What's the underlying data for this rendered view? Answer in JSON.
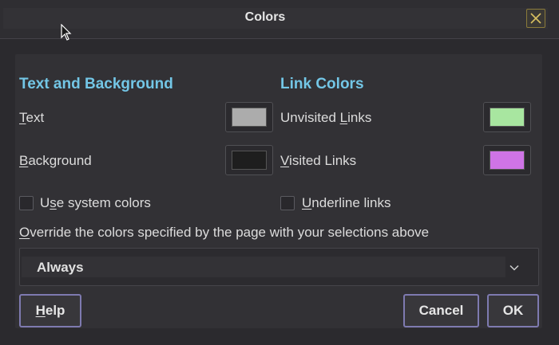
{
  "window": {
    "title": "Colors",
    "close_icon": "close-icon"
  },
  "text_background": {
    "heading": "Text and Background",
    "text_label_mnemonic": "T",
    "text_label_rest": "ext",
    "text_color": "#acacac",
    "background_label_mnemonic": "B",
    "background_label_rest": "ackground",
    "background_color": "#1e1e1e",
    "use_system_colors_prefix": "U",
    "use_system_colors_mnemonic": "s",
    "use_system_colors_rest": "e system colors",
    "use_system_colors_checked": false
  },
  "link_colors": {
    "heading": "Link Colors",
    "unvisited_prefix": "Unvisited ",
    "unvisited_mnemonic": "L",
    "unvisited_rest": "inks",
    "unvisited_color": "#a8e6a0",
    "visited_mnemonic": "V",
    "visited_rest": "isited Links",
    "visited_color": "#cf74e6",
    "underline_mnemonic": "U",
    "underline_rest": "nderline links",
    "underline_checked": false
  },
  "override": {
    "label_mnemonic": "O",
    "label_rest": "verride the colors specified by the page with your selections above",
    "selected": "Always"
  },
  "buttons": {
    "help_mnemonic": "H",
    "help_rest": "elp",
    "cancel": "Cancel",
    "ok": "OK"
  },
  "colors": {
    "accent_heading": "#73c6e6",
    "button_border": "#7e7ab0",
    "close_border": "#8a7a3a"
  }
}
